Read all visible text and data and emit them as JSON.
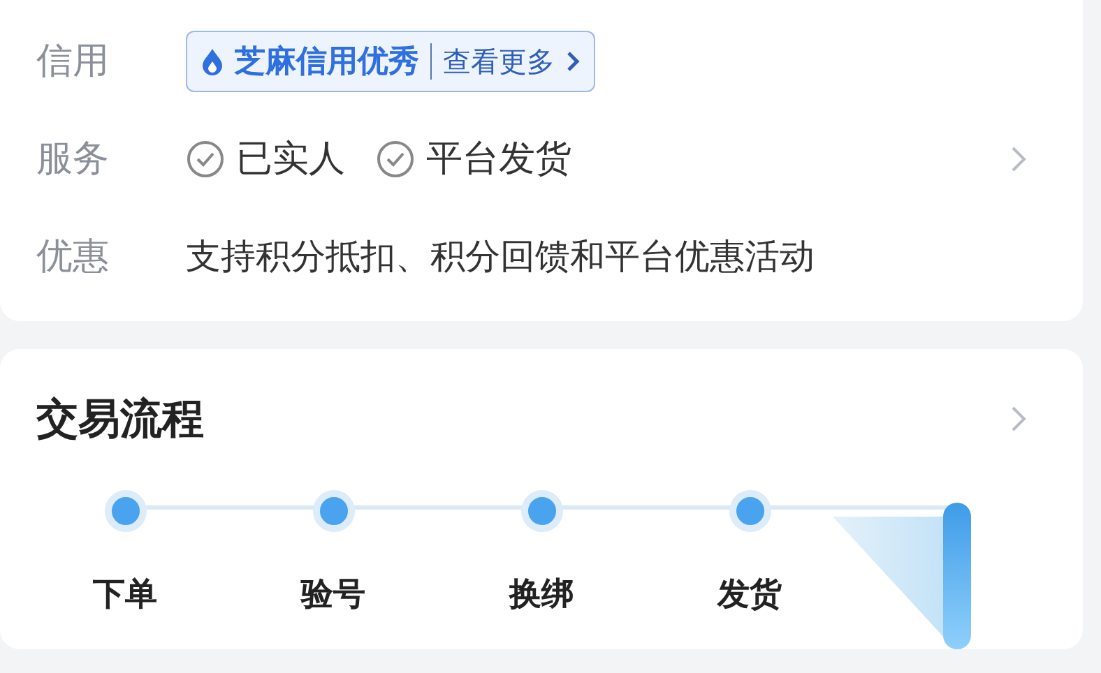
{
  "info_card": {
    "rows": [
      {
        "kind": "badge",
        "label": "信用",
        "badge": {
          "title": "芝麻信用优秀",
          "link": "查看更多"
        }
      },
      {
        "kind": "tags",
        "label": "服务",
        "tags": [
          "已实人",
          "平台发货"
        ],
        "chevron": true
      },
      {
        "kind": "text",
        "label": "优惠",
        "text": "支持积分抵扣、积分回馈和平台优惠活动"
      }
    ]
  },
  "process_card": {
    "title": "交易流程",
    "steps": [
      {
        "kind": "normal",
        "label": "下单"
      },
      {
        "kind": "normal",
        "label": "验号"
      },
      {
        "kind": "normal",
        "label": "换绑"
      },
      {
        "kind": "normal",
        "label": "发货"
      },
      {
        "kind": "folded"
      }
    ]
  }
}
